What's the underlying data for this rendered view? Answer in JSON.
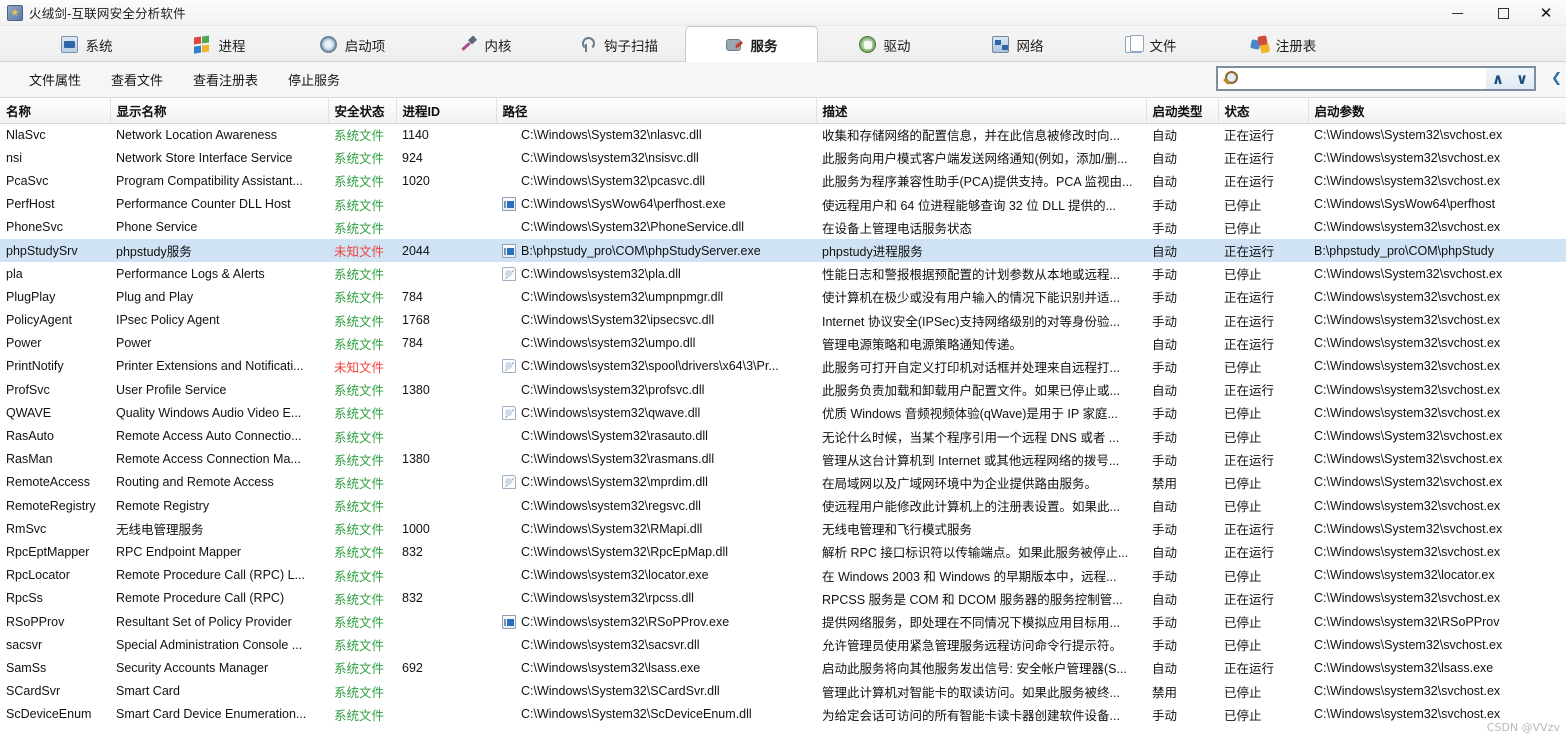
{
  "window": {
    "title": "火绒剑-互联网安全分析软件",
    "app_icon": "sword-shield-icon",
    "controls": {
      "minimize": "–",
      "maximize": "❐",
      "close": "✕"
    }
  },
  "tabs": [
    {
      "label": "系统",
      "icon": "system-icon",
      "active": false
    },
    {
      "label": "进程",
      "icon": "process-icon",
      "active": false
    },
    {
      "label": "启动项",
      "icon": "startup-icon",
      "active": false
    },
    {
      "label": "内核",
      "icon": "kernel-icon",
      "active": false
    },
    {
      "label": "钩子扫描",
      "icon": "hook-scan-icon",
      "active": false
    },
    {
      "label": "服务",
      "icon": "service-icon",
      "active": true
    },
    {
      "label": "驱动",
      "icon": "driver-icon",
      "active": false
    },
    {
      "label": "网络",
      "icon": "network-icon",
      "active": false
    },
    {
      "label": "文件",
      "icon": "file-icon",
      "active": false
    },
    {
      "label": "注册表",
      "icon": "registry-icon",
      "active": false
    }
  ],
  "toolbar": {
    "buttons": [
      "文件属性",
      "查看文件",
      "查看注册表",
      "停止服务"
    ],
    "search": {
      "icon": "search-magnifier-icon",
      "value": "",
      "placeholder": "",
      "prev_label": "∧",
      "next_label": "∨",
      "side_toggle": "chevron-icon"
    }
  },
  "table": {
    "columns": [
      "名称",
      "显示名称",
      "安全状态",
      "进程ID",
      "路径",
      "描述",
      "启动类型",
      "状态",
      "启动参数"
    ],
    "colors": {
      "safe": "#2e9e3e",
      "unknown": "#f0413a",
      "selection": "#cfe3f5"
    },
    "rows": [
      {
        "name": "NlaSvc",
        "display": "Network Location Awareness",
        "security": "系统文件",
        "sec_kind": "safe",
        "pid": "1140",
        "icon": "none",
        "path": "C:\\Windows\\System32\\nlasvc.dll",
        "desc": "收集和存储网络的配置信息，并在此信息被修改时向...",
        "startup": "自动",
        "state": "正在运行",
        "param": "C:\\Windows\\System32\\svchost.ex",
        "selected": false
      },
      {
        "name": "nsi",
        "display": "Network Store Interface Service",
        "security": "系统文件",
        "sec_kind": "safe",
        "pid": "924",
        "icon": "none",
        "path": "C:\\Windows\\system32\\nsisvc.dll",
        "desc": "此服务向用户模式客户端发送网络通知(例如，添加/删...",
        "startup": "自动",
        "state": "正在运行",
        "param": "C:\\Windows\\system32\\svchost.ex",
        "selected": false
      },
      {
        "name": "PcaSvc",
        "display": "Program Compatibility Assistant...",
        "security": "系统文件",
        "sec_kind": "safe",
        "pid": "1020",
        "icon": "none",
        "path": "C:\\Windows\\System32\\pcasvc.dll",
        "desc": "此服务为程序兼容性助手(PCA)提供支持。PCA 监视由...",
        "startup": "自动",
        "state": "正在运行",
        "param": "C:\\Windows\\system32\\svchost.ex",
        "selected": false
      },
      {
        "name": "PerfHost",
        "display": "Performance Counter DLL Host",
        "security": "系统文件",
        "sec_kind": "safe",
        "pid": "",
        "icon": "exe",
        "path": "C:\\Windows\\SysWow64\\perfhost.exe",
        "desc": "使远程用户和 64 位进程能够查询 32 位 DLL 提供的...",
        "startup": "手动",
        "state": "已停止",
        "param": "C:\\Windows\\SysWow64\\perfhost",
        "selected": false
      },
      {
        "name": "PhoneSvc",
        "display": "Phone Service",
        "security": "系统文件",
        "sec_kind": "safe",
        "pid": "",
        "icon": "none",
        "path": "C:\\Windows\\System32\\PhoneService.dll",
        "desc": "在设备上管理电话服务状态",
        "startup": "手动",
        "state": "已停止",
        "param": "C:\\Windows\\system32\\svchost.ex",
        "selected": false
      },
      {
        "name": "phpStudySrv",
        "display": "phpstudy服务",
        "security": "未知文件",
        "sec_kind": "unknown",
        "pid": "2044",
        "icon": "exe",
        "path": "B:\\phpstudy_pro\\COM\\phpStudyServer.exe",
        "desc": "phpstudy进程服务",
        "startup": "自动",
        "state": "正在运行",
        "param": "B:\\phpstudy_pro\\COM\\phpStudy",
        "selected": true
      },
      {
        "name": "pla",
        "display": "Performance Logs & Alerts",
        "security": "系统文件",
        "sec_kind": "safe",
        "pid": "",
        "icon": "dll",
        "path": "C:\\Windows\\system32\\pla.dll",
        "desc": "性能日志和警报根据预配置的计划参数从本地或远程...",
        "startup": "手动",
        "state": "已停止",
        "param": "C:\\Windows\\System32\\svchost.ex",
        "selected": false
      },
      {
        "name": "PlugPlay",
        "display": "Plug and Play",
        "security": "系统文件",
        "sec_kind": "safe",
        "pid": "784",
        "icon": "none",
        "path": "C:\\Windows\\system32\\umpnpmgr.dll",
        "desc": "使计算机在极少或没有用户输入的情况下能识别并适...",
        "startup": "手动",
        "state": "正在运行",
        "param": "C:\\Windows\\system32\\svchost.ex",
        "selected": false
      },
      {
        "name": "PolicyAgent",
        "display": "IPsec Policy Agent",
        "security": "系统文件",
        "sec_kind": "safe",
        "pid": "1768",
        "icon": "none",
        "path": "C:\\Windows\\System32\\ipsecsvc.dll",
        "desc": "Internet 协议安全(IPSec)支持网络级别的对等身份验...",
        "startup": "手动",
        "state": "正在运行",
        "param": "C:\\Windows\\system32\\svchost.ex",
        "selected": false
      },
      {
        "name": "Power",
        "display": "Power",
        "security": "系统文件",
        "sec_kind": "safe",
        "pid": "784",
        "icon": "none",
        "path": "C:\\Windows\\system32\\umpo.dll",
        "desc": "管理电源策略和电源策略通知传递。",
        "startup": "自动",
        "state": "正在运行",
        "param": "C:\\Windows\\system32\\svchost.ex",
        "selected": false
      },
      {
        "name": "PrintNotify",
        "display": "Printer Extensions and Notificati...",
        "security": "未知文件",
        "sec_kind": "unknown",
        "pid": "",
        "icon": "dll",
        "path": "C:\\Windows\\system32\\spool\\drivers\\x64\\3\\Pr...",
        "desc": "此服务可打开自定义打印机对话框并处理来自远程打...",
        "startup": "手动",
        "state": "已停止",
        "param": "C:\\Windows\\system32\\svchost.ex",
        "selected": false
      },
      {
        "name": "ProfSvc",
        "display": "User Profile Service",
        "security": "系统文件",
        "sec_kind": "safe",
        "pid": "1380",
        "icon": "none",
        "path": "C:\\Windows\\system32\\profsvc.dll",
        "desc": "此服务负责加载和卸载用户配置文件。如果已停止或...",
        "startup": "自动",
        "state": "正在运行",
        "param": "C:\\Windows\\system32\\svchost.ex",
        "selected": false
      },
      {
        "name": "QWAVE",
        "display": "Quality Windows Audio Video E...",
        "security": "系统文件",
        "sec_kind": "safe",
        "pid": "",
        "icon": "dll",
        "path": "C:\\Windows\\system32\\qwave.dll",
        "desc": "优质 Windows 音频视频体验(qWave)是用于 IP 家庭...",
        "startup": "手动",
        "state": "已停止",
        "param": "C:\\Windows\\system32\\svchost.ex",
        "selected": false
      },
      {
        "name": "RasAuto",
        "display": "Remote Access Auto Connectio...",
        "security": "系统文件",
        "sec_kind": "safe",
        "pid": "",
        "icon": "none",
        "path": "C:\\Windows\\System32\\rasauto.dll",
        "desc": "无论什么时候，当某个程序引用一个远程 DNS 或者 ...",
        "startup": "手动",
        "state": "已停止",
        "param": "C:\\Windows\\System32\\svchost.ex",
        "selected": false
      },
      {
        "name": "RasMan",
        "display": "Remote Access Connection Ma...",
        "security": "系统文件",
        "sec_kind": "safe",
        "pid": "1380",
        "icon": "none",
        "path": "C:\\Windows\\System32\\rasmans.dll",
        "desc": "管理从这台计算机到 Internet 或其他远程网络的拨号...",
        "startup": "手动",
        "state": "正在运行",
        "param": "C:\\Windows\\System32\\svchost.ex",
        "selected": false
      },
      {
        "name": "RemoteAccess",
        "display": "Routing and Remote Access",
        "security": "系统文件",
        "sec_kind": "safe",
        "pid": "",
        "icon": "dll",
        "path": "C:\\Windows\\System32\\mprdim.dll",
        "desc": "在局域网以及广域网环境中为企业提供路由服务。",
        "startup": "禁用",
        "state": "已停止",
        "param": "C:\\Windows\\System32\\svchost.ex",
        "selected": false
      },
      {
        "name": "RemoteRegistry",
        "display": "Remote Registry",
        "security": "系统文件",
        "sec_kind": "safe",
        "pid": "",
        "icon": "none",
        "path": "C:\\Windows\\system32\\regsvc.dll",
        "desc": "使远程用户能修改此计算机上的注册表设置。如果此...",
        "startup": "自动",
        "state": "已停止",
        "param": "C:\\Windows\\system32\\svchost.ex",
        "selected": false
      },
      {
        "name": "RmSvc",
        "display": "无线电管理服务",
        "security": "系统文件",
        "sec_kind": "safe",
        "pid": "1000",
        "icon": "none",
        "path": "C:\\Windows\\System32\\RMapi.dll",
        "desc": "无线电管理和飞行模式服务",
        "startup": "手动",
        "state": "正在运行",
        "param": "C:\\Windows\\System32\\svchost.ex",
        "selected": false
      },
      {
        "name": "RpcEptMapper",
        "display": "RPC Endpoint Mapper",
        "security": "系统文件",
        "sec_kind": "safe",
        "pid": "832",
        "icon": "none",
        "path": "C:\\Windows\\System32\\RpcEpMap.dll",
        "desc": "解析 RPC 接口标识符以传输端点。如果此服务被停止...",
        "startup": "自动",
        "state": "正在运行",
        "param": "C:\\Windows\\system32\\svchost.ex",
        "selected": false
      },
      {
        "name": "RpcLocator",
        "display": "Remote Procedure Call (RPC) L...",
        "security": "系统文件",
        "sec_kind": "safe",
        "pid": "",
        "icon": "none",
        "path": "C:\\Windows\\system32\\locator.exe",
        "desc": "在 Windows 2003 和 Windows 的早期版本中，远程...",
        "startup": "手动",
        "state": "已停止",
        "param": "C:\\Windows\\system32\\locator.ex",
        "selected": false
      },
      {
        "name": "RpcSs",
        "display": "Remote Procedure Call (RPC)",
        "security": "系统文件",
        "sec_kind": "safe",
        "pid": "832",
        "icon": "none",
        "path": "C:\\Windows\\system32\\rpcss.dll",
        "desc": "RPCSS 服务是 COM 和 DCOM 服务器的服务控制管...",
        "startup": "自动",
        "state": "正在运行",
        "param": "C:\\Windows\\system32\\svchost.ex",
        "selected": false
      },
      {
        "name": "RSoPProv",
        "display": "Resultant Set of Policy Provider",
        "security": "系统文件",
        "sec_kind": "safe",
        "pid": "",
        "icon": "exe",
        "path": "C:\\Windows\\system32\\RSoPProv.exe",
        "desc": "提供网络服务，即处理在不同情况下模拟应用目标用...",
        "startup": "手动",
        "state": "已停止",
        "param": "C:\\Windows\\system32\\RSoPProv",
        "selected": false
      },
      {
        "name": "sacsvr",
        "display": "Special Administration Console ...",
        "security": "系统文件",
        "sec_kind": "safe",
        "pid": "",
        "icon": "none",
        "path": "C:\\Windows\\system32\\sacsvr.dll",
        "desc": "允许管理员使用紧急管理服务远程访问命令行提示符。",
        "startup": "手动",
        "state": "已停止",
        "param": "C:\\Windows\\System32\\svchost.ex",
        "selected": false
      },
      {
        "name": "SamSs",
        "display": "Security Accounts Manager",
        "security": "系统文件",
        "sec_kind": "safe",
        "pid": "692",
        "icon": "none",
        "path": "C:\\Windows\\system32\\lsass.exe",
        "desc": "启动此服务将向其他服务发出信号: 安全帐户管理器(S...",
        "startup": "自动",
        "state": "正在运行",
        "param": "C:\\Windows\\system32\\lsass.exe",
        "selected": false
      },
      {
        "name": "SCardSvr",
        "display": "Smart Card",
        "security": "系统文件",
        "sec_kind": "safe",
        "pid": "",
        "icon": "none",
        "path": "C:\\Windows\\System32\\SCardSvr.dll",
        "desc": "管理此计算机对智能卡的取读访问。如果此服务被终...",
        "startup": "禁用",
        "state": "已停止",
        "param": "C:\\Windows\\system32\\svchost.ex",
        "selected": false
      },
      {
        "name": "ScDeviceEnum",
        "display": "Smart Card Device Enumeration...",
        "security": "系统文件",
        "sec_kind": "safe",
        "pid": "",
        "icon": "none",
        "path": "C:\\Windows\\System32\\ScDeviceEnum.dll",
        "desc": "为给定会话可访问的所有智能卡读卡器创建软件设备...",
        "startup": "手动",
        "state": "已停止",
        "param": "C:\\Windows\\system32\\svchost.ex",
        "selected": false
      }
    ]
  },
  "watermark": "CSDN @VVzv"
}
